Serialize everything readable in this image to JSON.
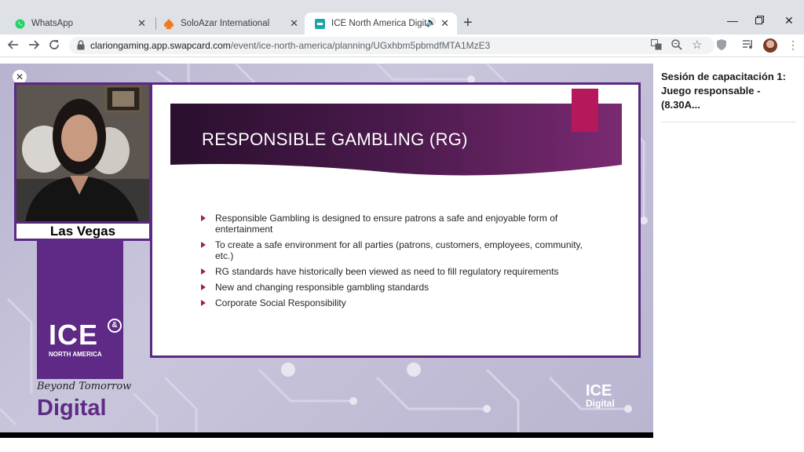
{
  "tabs": [
    {
      "title": "WhatsApp",
      "icon": "whatsapp-icon"
    },
    {
      "title": "SoloAzar International",
      "icon": "spade-icon"
    },
    {
      "title": "ICE North America Digital: co",
      "icon": "swapcard-icon",
      "active": true
    }
  ],
  "address_bar": {
    "host": "clariongaming.app.swapcard.com",
    "path": "/event/ice-north-america/planning/UGxhbm5pbmdfMTA1MzE3"
  },
  "video": {
    "location_label": "Las Vegas",
    "brand": {
      "logo": "ICE",
      "logo_mark": "&",
      "subtitle": "NORTH AMERICA",
      "tagline": "Beyond Tomorrow",
      "digital": "Digital"
    },
    "slide": {
      "title": "RESPONSIBLE GAMBLING (RG)",
      "bullets": [
        "Responsible Gambling is designed to ensure patrons a safe and enjoyable form of entertainment",
        "To create a safe environment for all parties (patrons, customers, employees, community, etc.)",
        "RG standards have historically been viewed as need to fill regulatory requirements",
        "New and changing responsible gambling standards",
        "Corporate Social Responsibility"
      ]
    },
    "watermark": {
      "line1": "ICE",
      "line2": "Digital"
    }
  },
  "side_panel": {
    "title": "Sesión de capacitación 1: Juego responsable - (8.30A..."
  },
  "colors": {
    "brand_purple": "#5e2a86",
    "accent_magenta": "#b5195c",
    "bullet_arrow": "#9c1f5b"
  }
}
